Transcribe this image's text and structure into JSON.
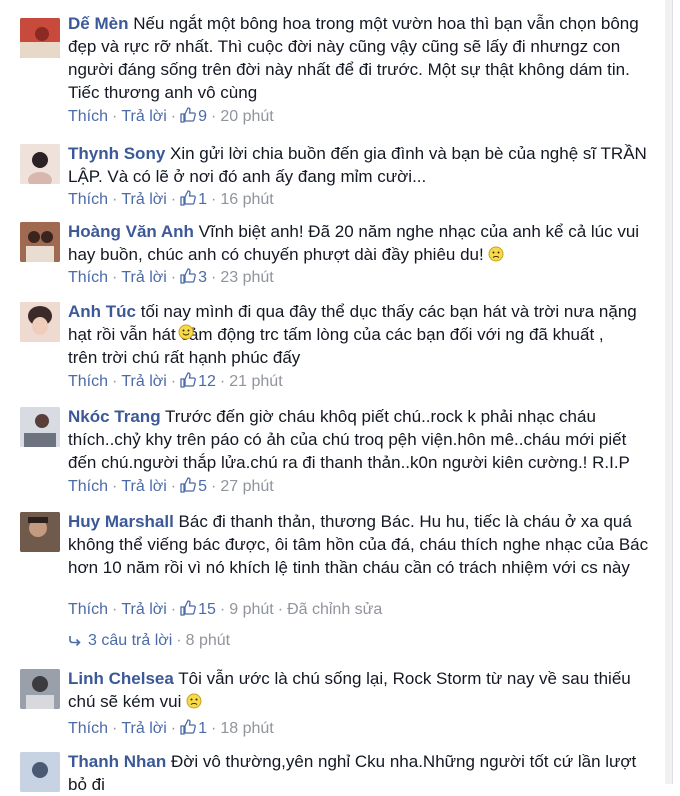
{
  "comments": [
    {
      "name": "Dế Mèn",
      "lines": [
        "Nếu ngắt một bông hoa trong một vườn hoa thì bạn vẫn chọn bông",
        "đẹp và rực rỡ nhất. Thì cuộc đời này cũng vậy cũng sẽ lấy đi nhưngz con",
        "người đáng sống trên đời này nhất để đi trước. Một sự thật không dám tin.",
        "Tiếc thương anh vô cùng"
      ],
      "like_label": "Thích",
      "reply_label": "Trả lời",
      "likes": "9",
      "time": "20 phút",
      "avatar_color": "#b23a32",
      "avatar_icon": "avatar-photo"
    },
    {
      "name": "Thynh Sony",
      "lines": [
        "Xin gửi lời chia buồn đến gia đình và bạn bè của nghệ sĩ TRẦN",
        "LẬP. Và có lẽ ở nơi đó anh ấy đang mỉm cười..."
      ],
      "like_label": "Thích",
      "reply_label": "Trả lời",
      "likes": "1",
      "time": "16 phút",
      "avatar_color": "#e7d6cf",
      "avatar_icon": "avatar-photo"
    },
    {
      "name": "Hoàng Văn Anh",
      "lines": [
        "Vĩnh biệt anh! Đã 20 năm nghe nhạc của anh kể cả lúc vui",
        "hay buồn, chúc anh có chuyến phượt dài đầy phiêu du!"
      ],
      "like_label": "Thích",
      "reply_label": "Trả lời",
      "likes": "3",
      "time": "23 phút",
      "avatar_color": "#7a4a3c",
      "avatar_icon": "avatar-photo"
    },
    {
      "name": "Anh Túc",
      "lines": [
        "tối nay mình đi qua đây thể dục thấy các bạn hát và trời nưa nặng",
        "hạt rồi vẫn hát  cảm động trc tấm lòng của các bạn đối với ng đã khuất ,",
        "trên trời chú rất hạnh phúc đấy"
      ],
      "like_label": "Thích",
      "reply_label": "Trả lời",
      "likes": "12",
      "time": "21 phút",
      "avatar_color": "#d9b9a8",
      "avatar_icon": "avatar-photo"
    },
    {
      "name": "Nkóc Trang",
      "lines": [
        "Trước đến giờ cháu khôq piết chú..rock k phải nhạc cháu",
        "thích..chỷ khy trên páo có ảh của chú troq pệh viện.hôn mê..cháu mới piết",
        "đến chú.người thắp lửa.chú ra đi thanh thản..k0n người kiên cường.! R.I.P"
      ],
      "like_label": "Thích",
      "reply_label": "Trả lời",
      "likes": "5",
      "time": "27 phút",
      "avatar_color": "#c9ccd3",
      "avatar_icon": "avatar-photo"
    },
    {
      "name": "Huy Marshall",
      "lines": [
        "Bác đi thanh thản, thương Bác. Hu hu, tiếc là cháu ở xa quá",
        "không thể viếng bác được, ôi tâm hồn của đá, cháu thích nghe nhạc của Bác",
        "hơn 10 năm rồi vì nó khích lệ tinh thần cháu cần có trách nhiệm với cs này"
      ],
      "like_label": "Thích",
      "reply_label": "Trả lời",
      "likes": "15",
      "time": "9 phút",
      "edited": "Đã chỉnh sửa",
      "avatar_color": "#5a4a40",
      "avatar_icon": "avatar-photo"
    },
    {
      "name": "Linh Chelsea",
      "lines": [
        "Tôi vẫn ước là chú sống lại, Rock Storm từ nay về sau thiếu",
        "chú sẽ kém vui"
      ],
      "like_label": "Thích",
      "reply_label": "Trả lời",
      "likes": "1",
      "time": "18 phút",
      "avatar_color": "#8a8f99",
      "avatar_icon": "avatar-photo"
    },
    {
      "name": "Thanh Nhan",
      "lines": [
        "Đời vô thường,yên nghỉ Cku nha.Những người tốt cứ lần lượt",
        "bỏ đi"
      ],
      "avatar_color": "#b9c6d9",
      "avatar_icon": "avatar-photo"
    }
  ],
  "replies_row": {
    "count_label": "3 câu trả lời",
    "time": "8 phút"
  },
  "icons": {
    "like": "thumbs-up-icon",
    "smile": "smiley-emoji-icon",
    "frown": "frown-emoji-icon",
    "reply_arrow": "reply-arrow-icon"
  },
  "colors": {
    "name": "#3b5998",
    "link": "#4b6ba8",
    "meta": "#90949c",
    "text": "#141823"
  }
}
